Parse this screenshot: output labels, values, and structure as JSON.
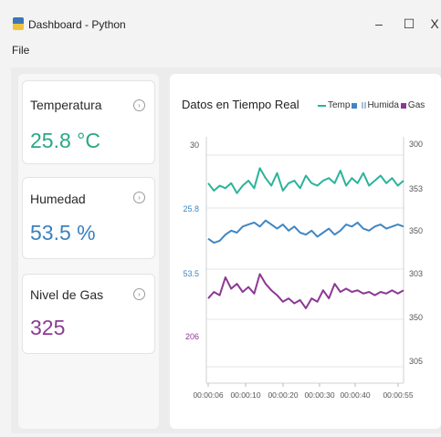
{
  "window": {
    "title": "Dashboard - Python",
    "minimize_label": "–",
    "maximize_label": "☐",
    "close_label": "X"
  },
  "menu": {
    "file_label": "File"
  },
  "cards": [
    {
      "label": "Temperatura",
      "value": "25.8 °C",
      "color": "#2aa784",
      "info_icon": "info-icon"
    },
    {
      "label": "Humedad",
      "value": "53.5 %",
      "color": "#3b80be",
      "info_icon": "info-icon"
    },
    {
      "label": "Nivel de Gas",
      "value": "325",
      "color": "#8e3a96",
      "info_icon": "info-icon"
    }
  ],
  "chart": {
    "title": "Datos en Tiempo Real",
    "legend": {
      "temp": "Temp",
      "humedad": "Humida",
      "gas": "Gas"
    }
  },
  "chart_data": {
    "type": "line",
    "title": "Datos en Tiempo Real",
    "x": [
      "00:00:06",
      "00:00:10",
      "00:00:20",
      "00:00:30",
      "00:00:40",
      "00:00:55"
    ],
    "left_tick_labels": [
      "30",
      "25.8",
      "53.5",
      "206"
    ],
    "right_tick_labels": [
      "300",
      "353",
      "350",
      "303",
      "350",
      "305"
    ],
    "grid": true,
    "legend_position": "top-right",
    "colors": {
      "temp": "#2bb39c",
      "humedad": "#3f86c3",
      "gas": "#8c3894"
    },
    "series": [
      {
        "name": "Temp",
        "values": [
          25.9,
          25.6,
          25.8,
          25.7,
          25.9,
          25.5,
          25.8,
          26.0,
          25.7,
          26.5,
          26.1,
          25.8,
          26.3,
          25.6,
          25.9,
          26.0,
          25.7,
          26.2,
          25.9,
          25.8,
          26.0,
          26.1,
          25.9,
          26.4,
          25.8,
          26.1,
          25.9,
          26.3,
          25.8,
          26.0,
          26.2,
          25.9,
          26.1,
          25.8,
          26.0
        ]
      },
      {
        "name": "Humida",
        "values": [
          53.2,
          53.0,
          53.1,
          53.4,
          53.6,
          53.5,
          53.8,
          53.9,
          54.0,
          53.8,
          54.1,
          53.9,
          53.7,
          53.9,
          53.6,
          53.8,
          53.5,
          53.4,
          53.6,
          53.3,
          53.5,
          53.7,
          53.4,
          53.6,
          53.9,
          53.8,
          54.0,
          53.7,
          53.6,
          53.8,
          53.9,
          53.7,
          53.8,
          53.9,
          53.8
        ]
      },
      {
        "name": "Gas",
        "values": [
          318,
          322,
          320,
          331,
          324,
          327,
          322,
          325,
          321,
          333,
          327,
          323,
          320,
          316,
          318,
          315,
          317,
          312,
          318,
          316,
          323,
          318,
          327,
          322,
          324,
          322,
          323,
          321,
          322,
          320,
          322,
          321,
          323,
          321,
          323
        ]
      }
    ]
  }
}
